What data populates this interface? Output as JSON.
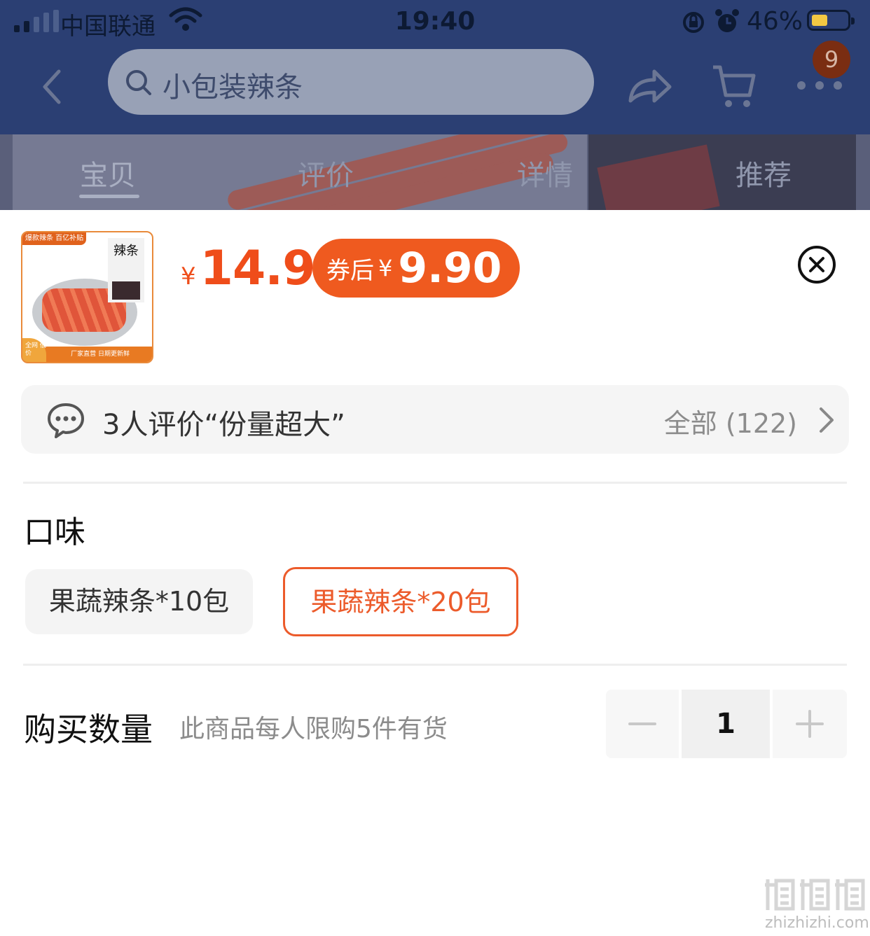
{
  "status_bar": {
    "carrier": "中国联通",
    "time": "19:40",
    "battery_pct": "46%",
    "battery_level": 0.46
  },
  "nav": {
    "search_placeholder": "小包装辣条",
    "cart_badge": "9"
  },
  "tabs": [
    {
      "label": "宝贝",
      "active": true
    },
    {
      "label": "评价",
      "active": false
    },
    {
      "label": "详情",
      "active": false
    },
    {
      "label": "推荐",
      "active": false
    }
  ],
  "product": {
    "thumb_tag": "爆款辣条 百亿补贴",
    "thumb_brand": "辣条",
    "thumb_strip": "厂家直营 日期更新鲜",
    "thumb_corner": "全网 低价",
    "price_symbol": "¥",
    "price": "14.9",
    "coupon_label": "券后",
    "coupon_symbol": "¥",
    "coupon_price": "9.90"
  },
  "review": {
    "summary": "3人评价“份量超大”",
    "all_label": "全部 (122)"
  },
  "flavor": {
    "label": "口味",
    "options": [
      {
        "label": "果蔬辣条*10包",
        "selected": false
      },
      {
        "label": "果蔬辣条*20包",
        "selected": true
      }
    ]
  },
  "quantity": {
    "label": "购买数量",
    "note": "此商品每人限购5件有货",
    "value": "1"
  },
  "watermark": {
    "text": "zhizhizhi.com"
  },
  "colors": {
    "accent": "#ef4d1a",
    "header_bg": "#2b3f73"
  }
}
